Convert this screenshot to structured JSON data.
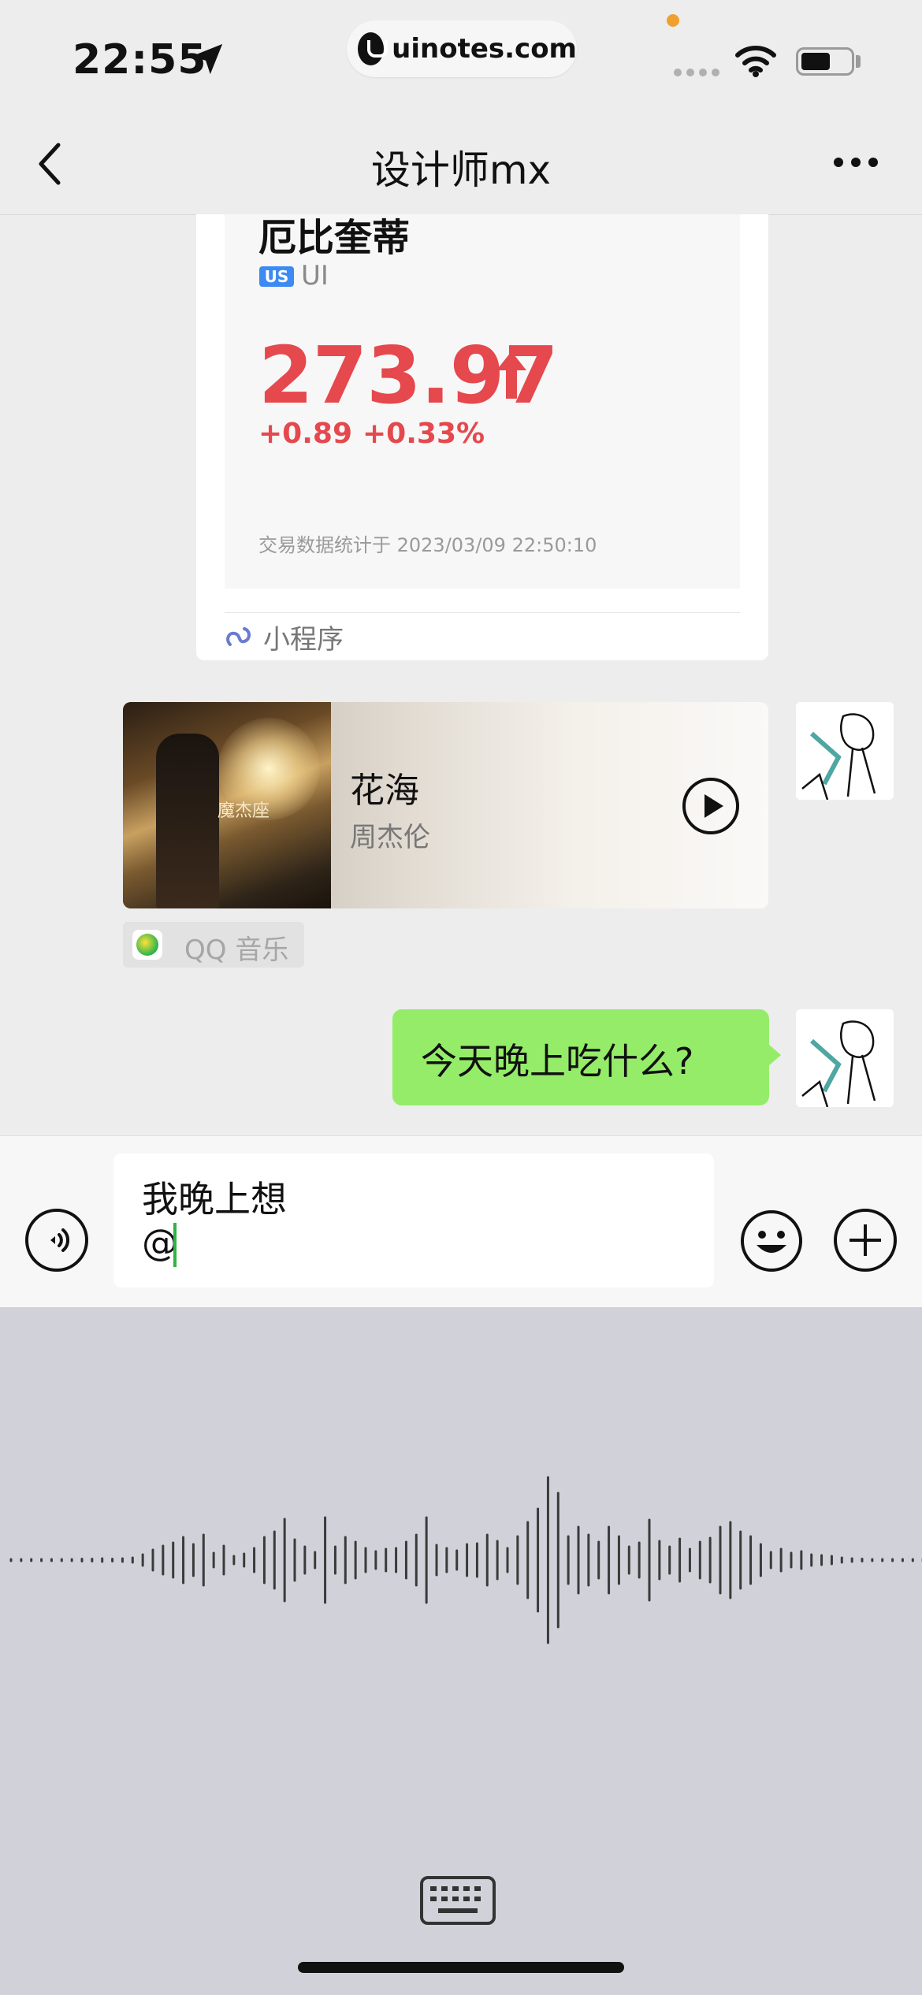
{
  "status_bar": {
    "time": "22:55",
    "url": "uinotes.com"
  },
  "nav": {
    "title": "设计师mx"
  },
  "mini_program_card": {
    "stock_name": "厄比奎蒂",
    "market_badge": "US",
    "market": "UI",
    "price": "273.97",
    "change": "+0.89",
    "change_pct": "+0.33%",
    "trade_time": "交易数据统计于 2023/03/09 22:50:10",
    "source_label": "小程序",
    "price_color": "#e5484d"
  },
  "music_card": {
    "song": "花海",
    "artist": "周杰伦",
    "album_text": "魔杰座",
    "source_label": "QQ 音乐"
  },
  "message": {
    "text": "今天晚上吃什么?",
    "bubble_color": "#95ec69"
  },
  "input": {
    "line1": "我晚上想",
    "line2": "@"
  },
  "icons": {
    "back": "chevron-left-icon",
    "more": "more-horizontal-icon",
    "voice": "voice-icon",
    "emoji": "emoji-icon",
    "plus": "plus-icon",
    "keyboard": "keyboard-icon"
  }
}
